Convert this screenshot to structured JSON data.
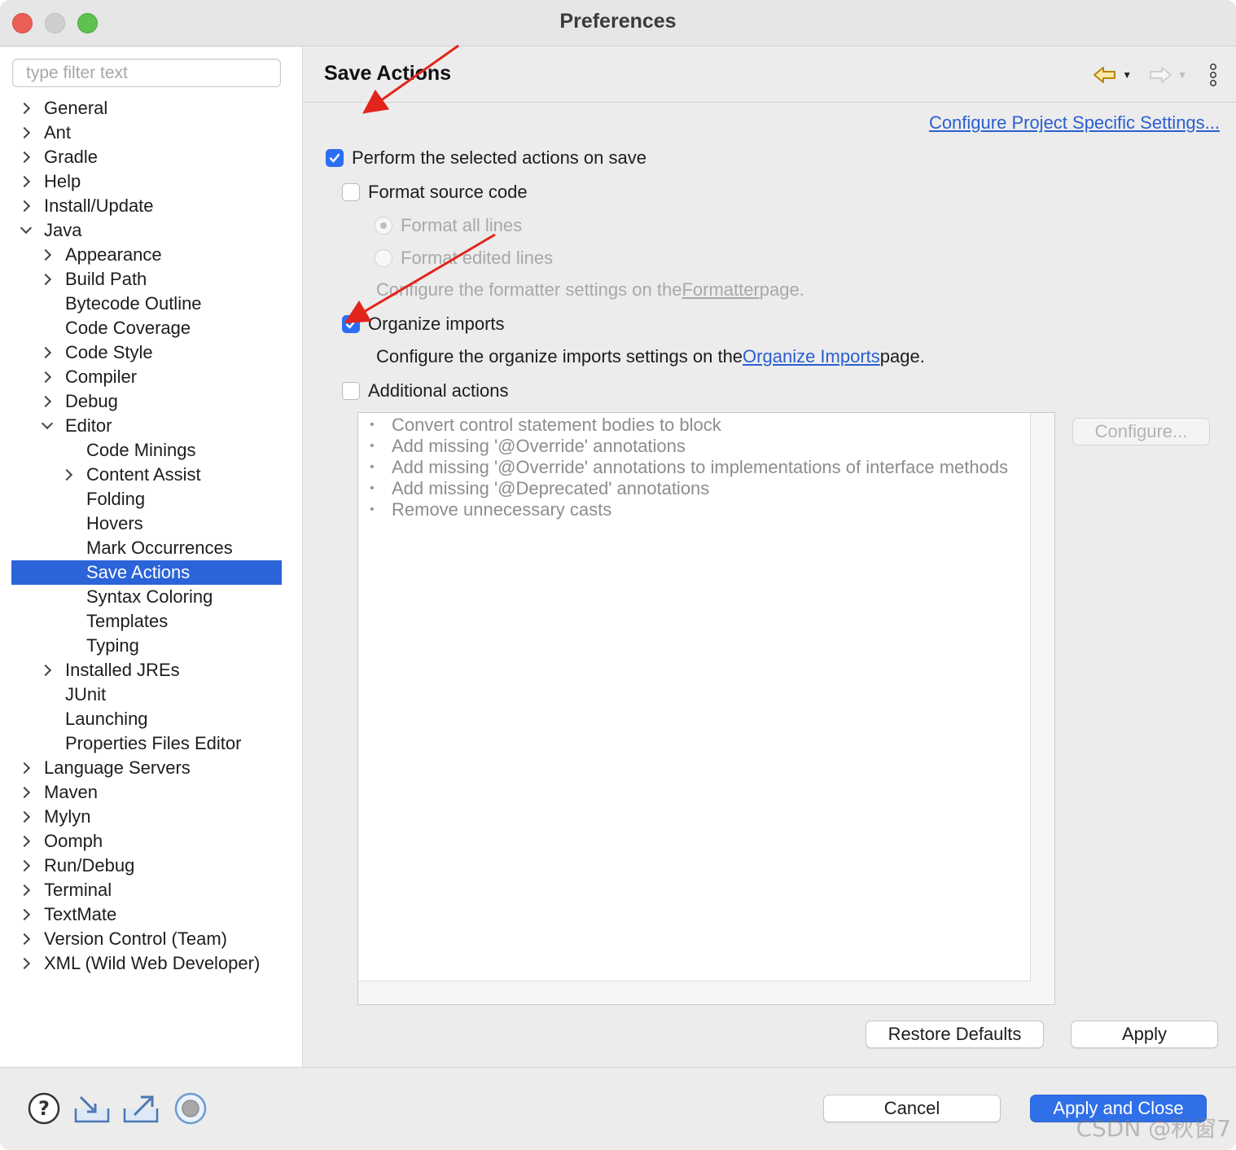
{
  "window": {
    "title": "Preferences"
  },
  "sidebar": {
    "filter_placeholder": "type filter text",
    "items": [
      {
        "label": "General",
        "level": 0,
        "twisty": "right"
      },
      {
        "label": "Ant",
        "level": 0,
        "twisty": "right"
      },
      {
        "label": "Gradle",
        "level": 0,
        "twisty": "right"
      },
      {
        "label": "Help",
        "level": 0,
        "twisty": "right"
      },
      {
        "label": "Install/Update",
        "level": 0,
        "twisty": "right"
      },
      {
        "label": "Java",
        "level": 0,
        "twisty": "down"
      },
      {
        "label": "Appearance",
        "level": 1,
        "twisty": "right"
      },
      {
        "label": "Build Path",
        "level": 1,
        "twisty": "right"
      },
      {
        "label": "Bytecode Outline",
        "level": 1,
        "twisty": "none"
      },
      {
        "label": "Code Coverage",
        "level": 1,
        "twisty": "none"
      },
      {
        "label": "Code Style",
        "level": 1,
        "twisty": "right"
      },
      {
        "label": "Compiler",
        "level": 1,
        "twisty": "right"
      },
      {
        "label": "Debug",
        "level": 1,
        "twisty": "right"
      },
      {
        "label": "Editor",
        "level": 1,
        "twisty": "down"
      },
      {
        "label": "Code Minings",
        "level": 2,
        "twisty": "none"
      },
      {
        "label": "Content Assist",
        "level": 2,
        "twisty": "right"
      },
      {
        "label": "Folding",
        "level": 2,
        "twisty": "none"
      },
      {
        "label": "Hovers",
        "level": 2,
        "twisty": "none"
      },
      {
        "label": "Mark Occurrences",
        "level": 2,
        "twisty": "none"
      },
      {
        "label": "Save Actions",
        "level": 2,
        "twisty": "none",
        "selected": true
      },
      {
        "label": "Syntax Coloring",
        "level": 2,
        "twisty": "none"
      },
      {
        "label": "Templates",
        "level": 2,
        "twisty": "none"
      },
      {
        "label": "Typing",
        "level": 2,
        "twisty": "none"
      },
      {
        "label": "Installed JREs",
        "level": 1,
        "twisty": "right"
      },
      {
        "label": "JUnit",
        "level": 1,
        "twisty": "none"
      },
      {
        "label": "Launching",
        "level": 1,
        "twisty": "none"
      },
      {
        "label": "Properties Files Editor",
        "level": 1,
        "twisty": "none"
      },
      {
        "label": "Language Servers",
        "level": 0,
        "twisty": "right"
      },
      {
        "label": "Maven",
        "level": 0,
        "twisty": "right"
      },
      {
        "label": "Mylyn",
        "level": 0,
        "twisty": "right"
      },
      {
        "label": "Oomph",
        "level": 0,
        "twisty": "right"
      },
      {
        "label": "Run/Debug",
        "level": 0,
        "twisty": "right"
      },
      {
        "label": "Terminal",
        "level": 0,
        "twisty": "right"
      },
      {
        "label": "TextMate",
        "level": 0,
        "twisty": "right"
      },
      {
        "label": "Version Control (Team)",
        "level": 0,
        "twisty": "right"
      },
      {
        "label": "XML (Wild Web Developer)",
        "level": 0,
        "twisty": "right"
      }
    ]
  },
  "main": {
    "title": "Save Actions",
    "project_link": "Configure Project Specific Settings...",
    "perform_label": "Perform the selected actions on save",
    "format_label": "Format source code",
    "format_all_label": "Format all lines",
    "format_edited_label": "Format edited lines",
    "formatter_text_pre": "Configure the formatter settings on the ",
    "formatter_link": "Formatter",
    "formatter_text_post": " page.",
    "organize_label": "Organize imports",
    "organize_text_pre": "Configure the organize imports settings on the ",
    "organize_link": "Organize Imports",
    "organize_text_post": " page.",
    "additional_label": "Additional actions",
    "additional_items": [
      "Convert control statement bodies to block",
      "Add missing '@Override' annotations",
      "Add missing '@Override' annotations to implementations of interface methods",
      "Add missing '@Deprecated' annotations",
      "Remove unnecessary casts"
    ],
    "configure_button": "Configure...",
    "restore_button": "Restore Defaults",
    "apply_button": "Apply",
    "checks": {
      "perform": true,
      "format": false,
      "format_all_selected": true,
      "organize": true,
      "additional": false
    }
  },
  "footer": {
    "cancel_button": "Cancel",
    "apply_close_button": "Apply and Close",
    "icons": [
      "help-icon",
      "import-icon",
      "export-icon",
      "record-icon"
    ]
  },
  "watermark": "CSDN @秋窗7",
  "colors": {
    "accent": "#2b63d9",
    "link": "#2a5fd0",
    "annotation_arrow": "#e3241b"
  }
}
